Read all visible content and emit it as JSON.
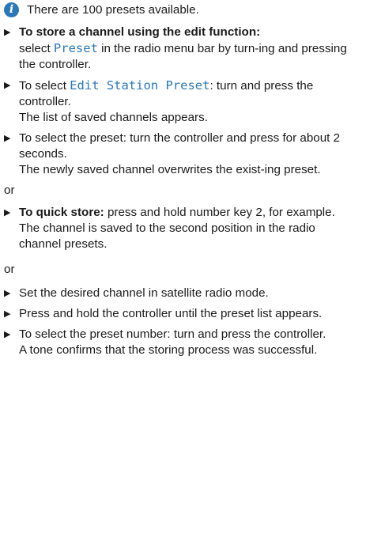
{
  "note": {
    "icon": "info-icon",
    "text": "There are 100 presets available."
  },
  "section1": {
    "step1": {
      "bold": "To store a channel using the edit function:",
      "pre": "select ",
      "term": "Preset",
      "post": " in the radio menu bar by turn-ing and pressing the controller."
    },
    "step2": {
      "pre": "To select ",
      "term": "Edit Station Preset",
      "post": ": turn and press the controller.",
      "result": "The list of saved channels appears."
    },
    "step3": {
      "text": "To select the preset: turn the controller and press for about 2 seconds.",
      "result": "The newly saved channel overwrites the exist-ing preset."
    }
  },
  "or_label": "or",
  "section2": {
    "step1": {
      "bold": "To quick store:",
      "text": " press and hold number key 2, for example.",
      "result": "The channel is saved to the second position in the radio channel presets."
    }
  },
  "section3": {
    "step1": {
      "text": "Set the desired channel in satellite radio mode."
    },
    "step2": {
      "text": "Press and hold the controller until the preset list appears."
    },
    "step3": {
      "text": "To select the preset number: turn and press the controller.",
      "result": "A tone confirms that the storing process was successful."
    }
  }
}
